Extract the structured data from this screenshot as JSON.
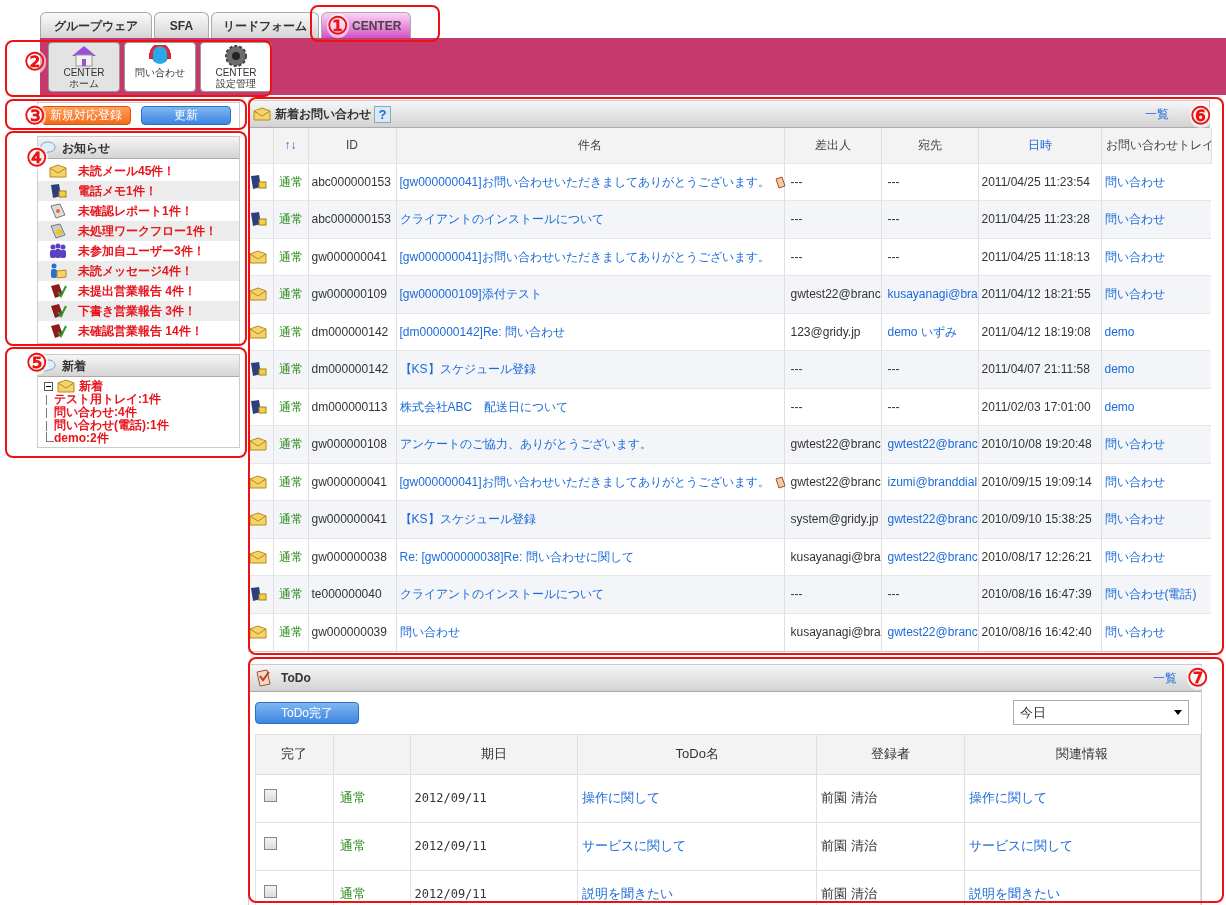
{
  "tabs": [
    {
      "label": "グループウェア",
      "selected": false
    },
    {
      "label": "SFA",
      "selected": false
    },
    {
      "label": "リードフォーム",
      "selected": false
    },
    {
      "label": "CENTER",
      "selected": true
    }
  ],
  "toolbar": [
    {
      "kind": "home",
      "label": "CENTER\nホーム",
      "selected": true
    },
    {
      "kind": "headset",
      "label": "問い合わせ",
      "selected": false
    },
    {
      "kind": "gear",
      "label": "CENTER\n設定管理",
      "selected": false
    }
  ],
  "actions": [
    {
      "kind": "orange",
      "label": "新規対応登録"
    },
    {
      "kind": "blue",
      "label": "更新"
    }
  ],
  "notices": {
    "title": "お知らせ",
    "items": [
      {
        "kind": "mail",
        "text": "未読メール45件！"
      },
      {
        "kind": "memo",
        "text": "電話メモ1件！"
      },
      {
        "kind": "report",
        "text": "未確認レポート1件！"
      },
      {
        "kind": "workflow",
        "text": "未処理ワークフロー1件！"
      },
      {
        "kind": "users",
        "text": "未参加自ユーザー3件！"
      },
      {
        "kind": "message",
        "text": "未読メッセージ4件！"
      },
      {
        "kind": "book",
        "text": "未提出営業報告 4件！"
      },
      {
        "kind": "book",
        "text": "下書き営業報告 3件！"
      },
      {
        "kind": "book",
        "text": "未確認営業報告 14件！"
      }
    ]
  },
  "new_items": {
    "title": "新着",
    "tree": [
      {
        "label": "新着",
        "expanded": true,
        "children": [
          {
            "label": "テスト用トレイ:1件"
          },
          {
            "label": "問い合わせ:4件"
          },
          {
            "label": "問い合わせ(電話):1件"
          },
          {
            "label": "demo:2件"
          }
        ]
      }
    ]
  },
  "inquiries": {
    "title": "新着お問い合わせ",
    "help": "?",
    "list_link": "一覧",
    "columns": [
      "↑↓",
      "ID",
      "件名",
      "差出人",
      "宛先",
      "日時",
      "お問い合わせトレイ"
    ],
    "rows": [
      {
        "kind": "memo",
        "priority": "通常",
        "id": "abc000000153",
        "subject": "[gw000000041]お問い合わせいただきましてありがとうございます。",
        "attachment": true,
        "sender": "---",
        "recipient": "---",
        "recipient_link": false,
        "date": "2011/04/25 11:23:54",
        "tray": "問い合わせ"
      },
      {
        "kind": "memo",
        "priority": "通常",
        "id": "abc000000153",
        "subject": "クライアントのインストールについて",
        "attachment": false,
        "sender": "---",
        "recipient": "---",
        "recipient_link": false,
        "date": "2011/04/25 11:23:28",
        "tray": "問い合わせ"
      },
      {
        "kind": "mail",
        "priority": "通常",
        "id": "gw000000041",
        "subject": "[gw000000041]お問い合わせいただきましてありがとうございます。",
        "attachment": false,
        "sender": "---",
        "recipient": "---",
        "recipient_link": false,
        "date": "2011/04/25 11:18:13",
        "tray": "問い合わせ"
      },
      {
        "kind": "mail",
        "priority": "通常",
        "id": "gw000000109",
        "subject": "[gw000000109]添付テスト",
        "attachment": false,
        "sender": "gwtest22@branc",
        "recipient": "kusayanagi@bra",
        "recipient_link": true,
        "date": "2011/04/12 18:21:55",
        "tray": "問い合わせ"
      },
      {
        "kind": "mail",
        "priority": "通常",
        "id": "dm000000142",
        "subject": "[dm000000142]Re: 問い合わせ",
        "attachment": false,
        "sender": "123@gridy.jp",
        "recipient": "demo いずみ",
        "recipient_link": true,
        "date": "2011/04/12 18:19:08",
        "tray": "demo"
      },
      {
        "kind": "memo",
        "priority": "通常",
        "id": "dm000000142",
        "subject": "【KS】スケジュール登録",
        "attachment": false,
        "sender": "---",
        "recipient": "---",
        "recipient_link": false,
        "date": "2011/04/07 21:11:58",
        "tray": "demo"
      },
      {
        "kind": "memo",
        "priority": "通常",
        "id": "dm000000113",
        "subject": "株式会社ABC　配送日について",
        "attachment": false,
        "sender": "---",
        "recipient": "---",
        "recipient_link": false,
        "date": "2011/02/03 17:01:00",
        "tray": "demo"
      },
      {
        "kind": "mail",
        "priority": "通常",
        "id": "gw000000108",
        "subject": "アンケートのご協力、ありがとうございます。",
        "attachment": false,
        "sender": "gwtest22@branc",
        "recipient": "gwtest22@branc",
        "recipient_link": true,
        "date": "2010/10/08 19:20:48",
        "tray": "問い合わせ"
      },
      {
        "kind": "mail",
        "priority": "通常",
        "id": "gw000000041",
        "subject": "[gw000000041]お問い合わせいただきましてありがとうございます。",
        "attachment": true,
        "sender": "gwtest22@branc",
        "recipient": "izumi@branddial",
        "recipient_link": true,
        "date": "2010/09/15 19:09:14",
        "tray": "問い合わせ"
      },
      {
        "kind": "mail",
        "priority": "通常",
        "id": "gw000000041",
        "subject": "【KS】スケジュール登録",
        "attachment": false,
        "sender": "system@gridy.jp",
        "recipient": "gwtest22@branc",
        "recipient_link": true,
        "date": "2010/09/10 15:38:25",
        "tray": "問い合わせ"
      },
      {
        "kind": "mail",
        "priority": "通常",
        "id": "gw000000038",
        "subject": "Re: [gw000000038]Re: 問い合わせに関して",
        "attachment": false,
        "sender": "kusayanagi@bra",
        "recipient": "gwtest22@branc",
        "recipient_link": true,
        "date": "2010/08/17 12:26:21",
        "tray": "問い合わせ"
      },
      {
        "kind": "memo",
        "priority": "通常",
        "id": "te000000040",
        "subject": "クライアントのインストールについて",
        "attachment": false,
        "sender": "---",
        "recipient": "---",
        "recipient_link": false,
        "date": "2010/08/16 16:47:39",
        "tray": "問い合わせ(電話)"
      },
      {
        "kind": "mail",
        "priority": "通常",
        "id": "gw000000039",
        "subject": "問い合わせ",
        "attachment": false,
        "sender": "kusayanagi@bra",
        "recipient": "gwtest22@branc",
        "recipient_link": true,
        "date": "2010/08/16 16:42:40",
        "tray": "問い合わせ"
      }
    ]
  },
  "todo": {
    "title": "ToDo",
    "list_link": "一覧",
    "done_button": "ToDo完了",
    "period": "今日",
    "columns": [
      "完了",
      "期日",
      "ToDo名",
      "登録者",
      "関連情報"
    ],
    "rows": [
      {
        "checked": false,
        "priority": "通常",
        "due": "2012/09/11",
        "name": "操作に関して",
        "owner": "前園 清治",
        "related": "操作に関して"
      },
      {
        "checked": false,
        "priority": "通常",
        "due": "2012/09/11",
        "name": "サービスに関して",
        "owner": "前園 清治",
        "related": "サービスに関して"
      },
      {
        "checked": false,
        "priority": "通常",
        "due": "2012/09/11",
        "name": "説明を聞きたい",
        "owner": "前園 清治",
        "related": "説明を聞きたい"
      }
    ]
  },
  "callouts": [
    {
      "label": "①"
    },
    {
      "label": "②"
    },
    {
      "label": "③"
    },
    {
      "label": "④"
    },
    {
      "label": "⑤"
    },
    {
      "label": "⑥"
    },
    {
      "label": "⑦"
    }
  ]
}
